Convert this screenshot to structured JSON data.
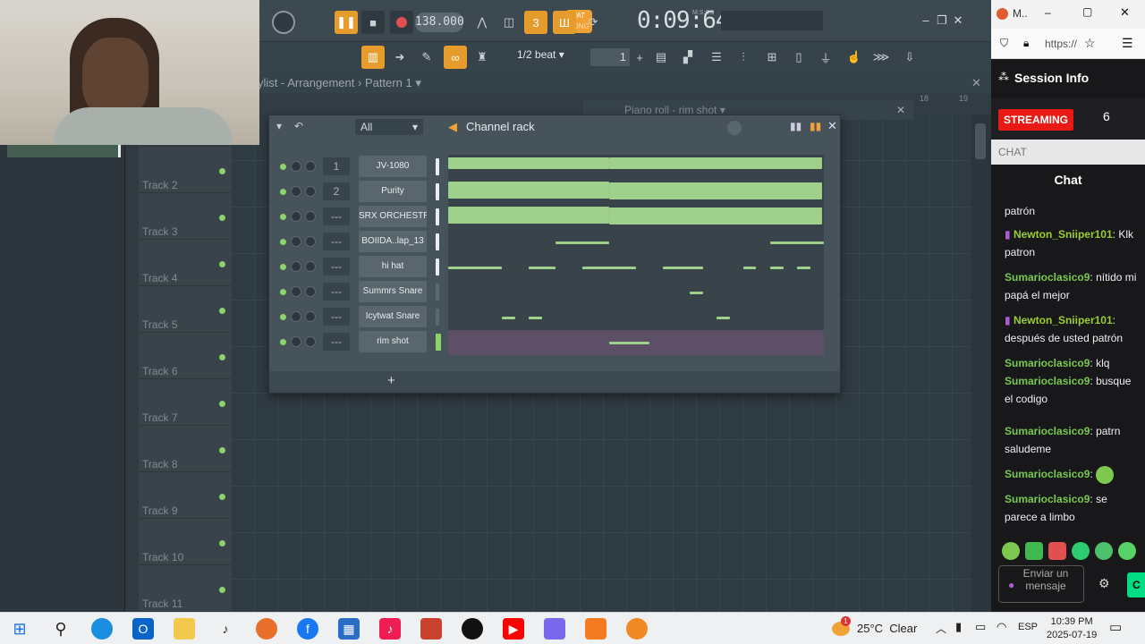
{
  "fl": {
    "pat_label": "PAT",
    "song_label": "SONG",
    "bpm": "138.000",
    "time": "0:09:64",
    "time_unit": "M:S:CS",
    "snap": "1/2 beat",
    "pattern_selector": "1",
    "playlist_title": "ylist - Arrangement",
    "playlist_pattern": "Pattern 1",
    "piano_roll_title": "Piano roll - rim shot",
    "ruler_marks": [
      "18",
      "19"
    ],
    "tracks": [
      "Track 2",
      "Track 3",
      "Track 4",
      "Track 5",
      "Track 6",
      "Track 7",
      "Track 8",
      "Track 9",
      "Track 10",
      "Track 11"
    ],
    "rack": {
      "title": "Channel rack",
      "filter": "All",
      "add_label": "+",
      "channels": [
        {
          "num": "1",
          "name": "JV-1080"
        },
        {
          "num": "2",
          "name": "Purity"
        },
        {
          "num": "---",
          "name": "SRX ORCHESTRA"
        },
        {
          "num": "---",
          "name": "BOIIDA..lap_13"
        },
        {
          "num": "---",
          "name": "hi hat"
        },
        {
          "num": "---",
          "name": "Summrs Snare"
        },
        {
          "num": "---",
          "name": "Icytwat Snare"
        },
        {
          "num": "---",
          "name": "rim shot"
        }
      ]
    }
  },
  "browser": {
    "tab": "M..",
    "url": "https://",
    "session_title": "Session Info",
    "streaming": "STREAMING",
    "viewers": "6",
    "chat_section": "CHAT",
    "chat_header": "Chat",
    "messages": [
      {
        "user": "",
        "text": "patrón"
      },
      {
        "user": "Newton_Sniiper101",
        "text": "Klk patron"
      },
      {
        "user": "Sumarioclasico9",
        "text": "nítido mi papá el mejor"
      },
      {
        "user": "Newton_Sniiper101",
        "text": "después de usted patrón"
      },
      {
        "user": "Sumarioclasico9",
        "text": "klq"
      },
      {
        "user": "Sumarioclasico9",
        "text": "busque el codigo"
      },
      {
        "user": "Sumarioclasico9",
        "text": "patrn saludeme"
      },
      {
        "user": "Sumarioclasico9",
        "text": ""
      },
      {
        "user": "Sumarioclasico9",
        "text": "se parece a limbo"
      }
    ],
    "input_placeholder": "Enviar un mensaje",
    "send_label": "C"
  },
  "taskbar": {
    "temperature": "25°C",
    "weather": "Clear",
    "weather_badge": "1",
    "language": "ESP",
    "time": "10:39 PM",
    "date": "2025-07-19"
  },
  "colors": {
    "accent": "#e69c2c",
    "note": "#9fd18c",
    "streaming": "#e91916"
  }
}
